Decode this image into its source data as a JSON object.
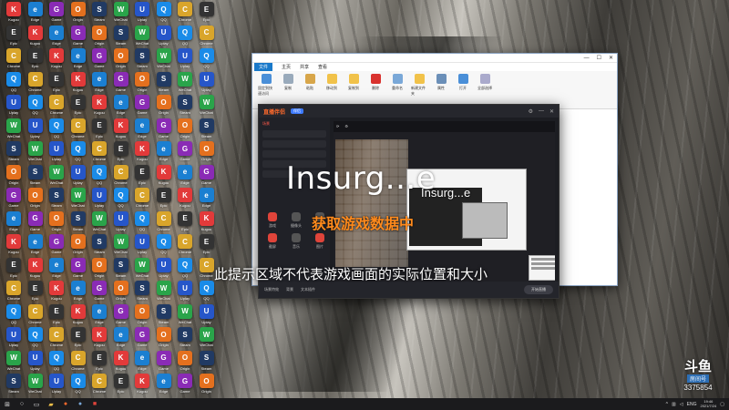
{
  "overlay": {
    "title_large": "Insurg...e",
    "title_small": "Insurg...e",
    "orange_text": "获取游戏数据中",
    "caption": "此提示区域不代表游戏画面的实际位置和大小"
  },
  "explorer": {
    "tabs": [
      "文件",
      "主页",
      "共享",
      "查看"
    ],
    "ribbon_buttons": [
      "固定到快速访问",
      "复制",
      "粘贴",
      "移动到",
      "复制到",
      "删除",
      "重命名",
      "新建文件夹",
      "属性",
      "打开",
      "全部选择"
    ],
    "ribbon_groups": [
      "剪贴板",
      "组织",
      "新建",
      "打开",
      "选择"
    ]
  },
  "stream_app": {
    "logo": "直播伴侣",
    "badge": "伴侣",
    "sidebar_tabs": [
      "场景"
    ],
    "tools": [
      "游戏",
      "摄像头",
      "窗口",
      "截屏",
      "音乐",
      "图片"
    ],
    "footer_items": [
      "场景特效",
      "背景",
      "文本插件"
    ],
    "record_label": "开始直播"
  },
  "watermark": {
    "logo": "斗鱼",
    "sub": "房间号",
    "room_id": "3375854"
  },
  "taskbar": {
    "tray_lang": "ENG",
    "time": "19:46",
    "date": "2021/7/24"
  },
  "colors": {
    "accent_orange": "#ff8a1c",
    "explorer_file_tab": "#1979ca",
    "stream_bg": "#1c1d22",
    "taskbar": "#1b1b1d"
  },
  "desktop_icons": [
    {
      "label": "Kugou",
      "color": "#e23a3a",
      "glyph": "K"
    },
    {
      "label": "QQ",
      "color": "#1a8be8",
      "glyph": "Q"
    },
    {
      "label": "Steam",
      "color": "#213a63",
      "glyph": "S"
    },
    {
      "label": "Edge",
      "color": "#1b7fd1",
      "glyph": "e"
    },
    {
      "label": "Chrome",
      "color": "#d9a52b",
      "glyph": "C"
    },
    {
      "label": "WeChat",
      "color": "#2aa44a",
      "glyph": "W"
    },
    {
      "label": "Game",
      "color": "#8a2bb5",
      "glyph": "G"
    },
    {
      "label": "Epic",
      "color": "#333",
      "glyph": "E"
    },
    {
      "label": "Uplay",
      "color": "#2656c9",
      "glyph": "U"
    },
    {
      "label": "Origin",
      "color": "#e4701e",
      "glyph": "O"
    }
  ]
}
